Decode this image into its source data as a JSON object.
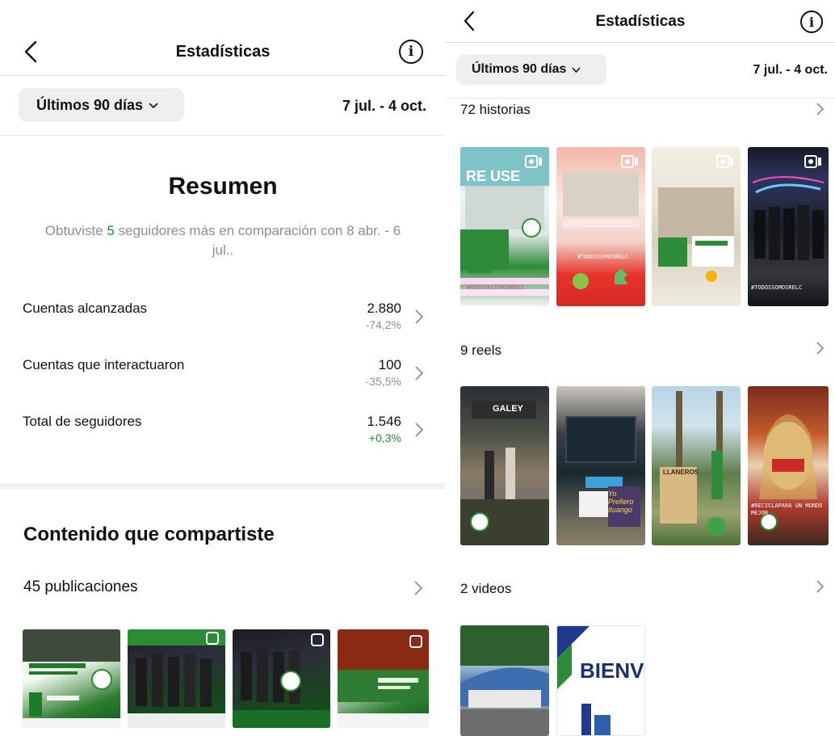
{
  "left": {
    "header": {
      "title": "Estadísticas"
    },
    "range": {
      "label": "Últimos 90 días",
      "dates": "7 jul. - 4 oct."
    },
    "summary": {
      "title": "Resumen",
      "text_before": "Obtuviste ",
      "highlight": "5",
      "text_after": " seguidores más en comparación con 8 abr. - 6 jul.."
    },
    "metrics": [
      {
        "label": "Cuentas alcanzadas",
        "value": "2.880",
        "change": "-74,2%"
      },
      {
        "label": "Cuentas que interactuaron",
        "value": "100",
        "change": "-35,5%"
      },
      {
        "label": "Total de seguidores",
        "value": "1.546",
        "change": "+0,3%"
      }
    ],
    "content": {
      "title": "Contenido que compartiste",
      "posts_label": "45 publicaciones"
    }
  },
  "right": {
    "header": {
      "title": "Estadísticas"
    },
    "range": {
      "label": "Últimos 90 días",
      "dates": "7 jul. - 4 oct."
    },
    "stories": {
      "label": "72 historias",
      "items": [
        {
          "overlay": "RE USE",
          "tag": "#MIESCRITORIORELC"
        },
        {
          "overlay": "",
          "tag": "#TODOSSOMOSRELC"
        },
        {
          "overlay": "",
          "tag": ""
        },
        {
          "overlay": "",
          "tag": "#TODOSSOMOSRELC"
        }
      ]
    },
    "reels": {
      "label": "9 reels",
      "items": [
        {
          "tag": "GALEY"
        },
        {
          "tag": "Yo Prefiero Ituango"
        },
        {
          "tag": "LLANEROS"
        },
        {
          "tag": "#RECICLAPARA UN MUNDO MEJOR"
        }
      ]
    },
    "videos": {
      "label": "2 videos",
      "items": [
        {
          "text": ""
        },
        {
          "text": "BIENV"
        }
      ]
    }
  }
}
